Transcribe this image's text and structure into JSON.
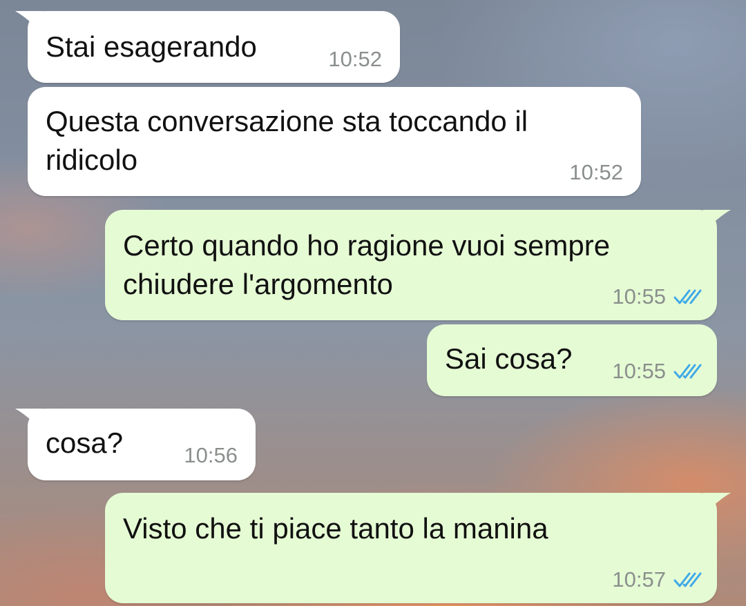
{
  "messages": [
    {
      "direction": "incoming",
      "text": "Stai esagerando",
      "time": "10:52"
    },
    {
      "direction": "incoming",
      "text_line1": "Questa conversazione sta toccando il",
      "text_line2": "ridicolo",
      "time": "10:52"
    },
    {
      "direction": "outgoing",
      "text_line1": "Certo quando ho ragione vuoi sempre",
      "text_line2": "chiudere l'argomento",
      "time": "10:55",
      "status": "read-double-check-icon"
    },
    {
      "direction": "outgoing",
      "text": "Sai cosa?",
      "time": "10:55",
      "status": "read-double-check-icon"
    },
    {
      "direction": "incoming",
      "text": "cosa?",
      "time": "10:56"
    },
    {
      "direction": "outgoing",
      "text": "Visto che ti piace tanto la manina",
      "time": "10:57",
      "status": "read-double-check-icon"
    }
  ],
  "colors": {
    "incoming_bubble": "#ffffff",
    "outgoing_bubble": "#e5fbd4",
    "read_tick": "#3fa9e8",
    "timestamp": "#8a8f8c"
  }
}
